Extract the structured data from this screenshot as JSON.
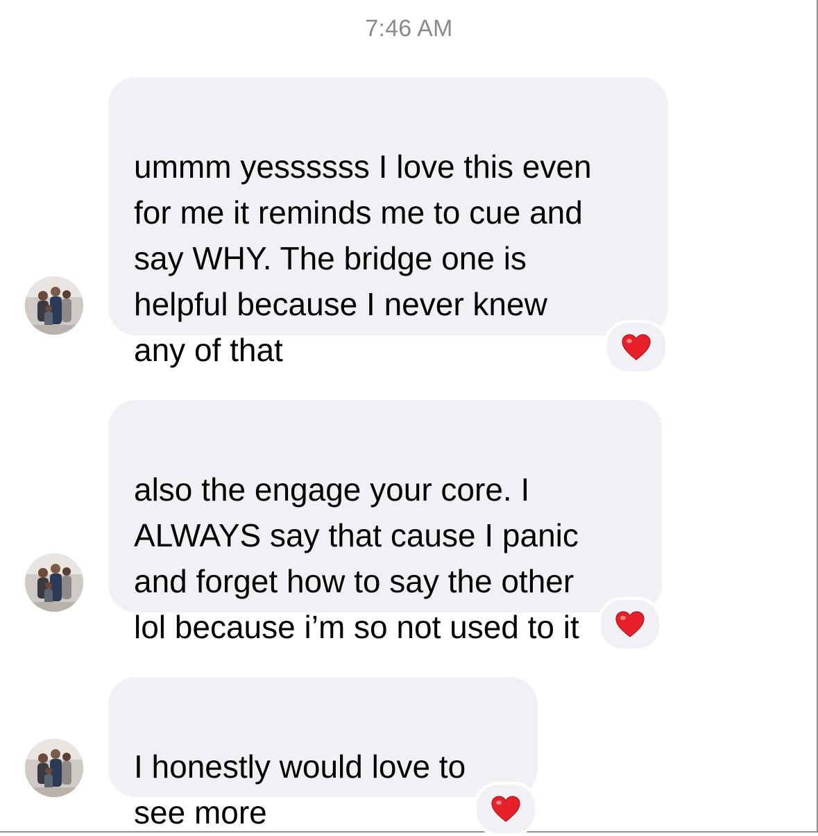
{
  "timestamp": "7:46 AM",
  "messages": [
    {
      "text": "ummm yessssss I love this even\nfor me it reminds me to cue and\nsay WHY. The bridge one is\nhelpful because I never knew\nany of that",
      "reaction": "heart"
    },
    {
      "text": "also the engage your core. I\nALWAYS say that cause I panic\nand forget how to say the other\nlol because i’m so not used to it",
      "reaction": "heart"
    },
    {
      "text": "I honestly would love to\nsee more",
      "reaction": "heart"
    }
  ],
  "colors": {
    "bubble": "#f0f0f5",
    "timestamp": "#8a8a8e",
    "heart": "#e8202a"
  }
}
